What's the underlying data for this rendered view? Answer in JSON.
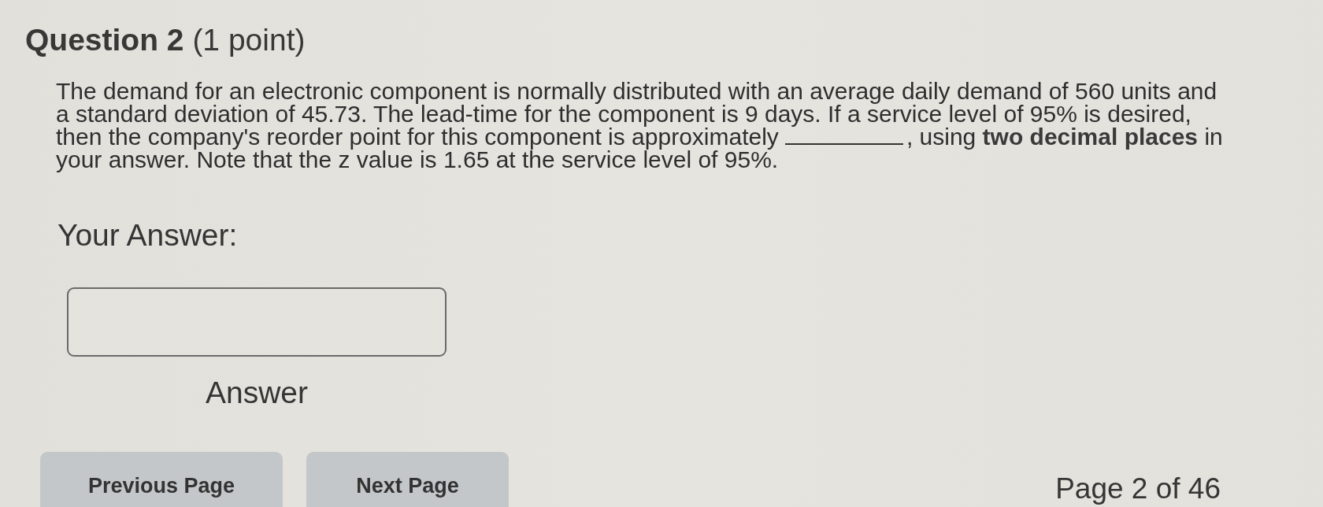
{
  "question": {
    "heading": "**Question 2** (1 point)",
    "prompt": {
      "before": "The demand for an electronic component is normally distributed with an average daily demand of 560 units and a standard deviation of 45.73. The lead-time for the component is 9 days. If a service level of 95% is desired, then the company's reorder point for this component is approximately",
      "after": ", using **two decimal places** in your answer. Note that the z value is 1.65 at the service level of 95%."
    }
  },
  "answer": {
    "label": "Your Answer:",
    "caption": "Answer"
  },
  "navigation": {
    "buttons": [
      {
        "label": "Previous Page"
      },
      {
        "label": "Next Page"
      }
    ],
    "page_indicator": "Page 2 of 46"
  }
}
